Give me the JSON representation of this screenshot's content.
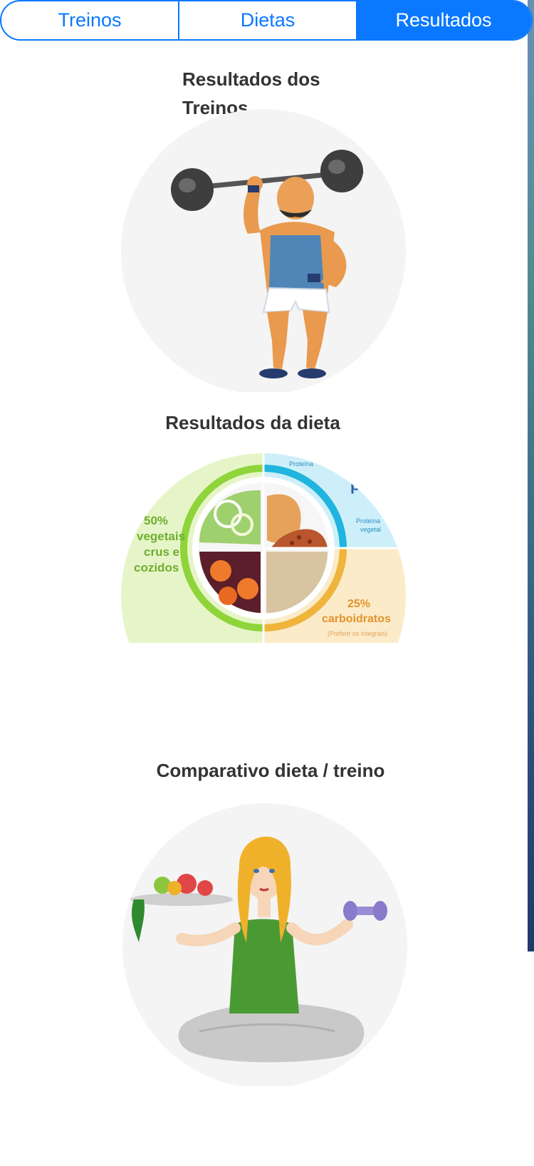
{
  "tabs": [
    {
      "label": "Treinos",
      "selected": false
    },
    {
      "label": "Dietas",
      "selected": false
    },
    {
      "label": "Resultados",
      "selected": true
    }
  ],
  "sections": [
    {
      "title": "Resultados dos Treinos.",
      "image": "muscleman-lifting-barbell"
    },
    {
      "title": "Resultados da dieta",
      "image": "healthy-plate-diagram"
    },
    {
      "title": "Comparativo dieta / treino",
      "image": "woman-balancing-salad-and-dumbbell"
    }
  ],
  "plate": {
    "left_label_1": "50%",
    "left_label_2": "vegetais",
    "left_label_3": "crus e",
    "left_label_4": "cozidos",
    "protein_top": "Proteína",
    "protein_letter": "p",
    "protein_vegetal_1": "Proteína",
    "protein_vegetal_2": "vegetal",
    "carbs_pct": "25%",
    "carbs_label": "carboidratos",
    "carbs_note": "(Preferir os integrais)"
  },
  "colors": {
    "accent": "#0a78ff",
    "title_text": "#333333"
  }
}
